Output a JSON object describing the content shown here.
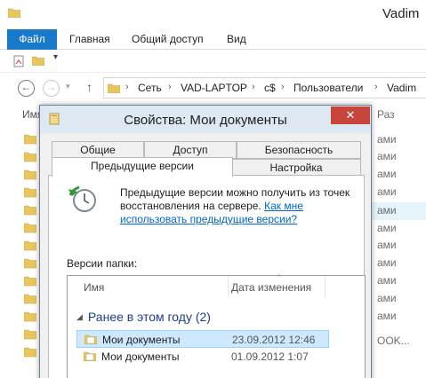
{
  "explorer": {
    "title": "Vadim",
    "ribbon_tabs": [
      "Файл",
      "Главная",
      "Общий доступ",
      "Вид"
    ],
    "address": [
      "Сеть",
      "VAD-LAPTOP",
      "c$",
      "Пользователи",
      "Vadim"
    ],
    "left_header": "Имя",
    "right_header": "Раз",
    "right_cells": [
      "ами",
      "ами",
      "ами",
      "ами",
      "ами",
      "ами",
      "ами",
      "ами",
      "ами",
      "ами",
      "ами",
      "OOK..."
    ]
  },
  "dialog": {
    "title": "Свойства: Мои документы",
    "close_label": "✕",
    "tabs_row1": [
      "Общие",
      "Доступ",
      "Безопасность"
    ],
    "tabs_row2": [
      "Предыдущие версии",
      "Настройка"
    ],
    "info_text": "Предыдущие версии можно получить из точек восстановления на сервере.",
    "info_link": "Как мне использовать предыдущие версии?",
    "versions_label": "Версии папки:",
    "columns": [
      "Имя",
      "Дата изменения"
    ],
    "group_label": "Ранее в этом году (2)",
    "rows": [
      {
        "name": "Мои документы",
        "date": "23.09.2012 12:46",
        "selected": true
      },
      {
        "name": "Мои документы",
        "date": "01.09.2012 1:07",
        "selected": false
      }
    ]
  },
  "colors": {
    "file_tab": "#1979ca",
    "close_button": "#c7453b",
    "link": "#0066cc",
    "selection": "#cde8ff"
  },
  "icons": [
    "folder-icon",
    "undo-icon",
    "back-icon",
    "forward-icon",
    "up-arrow-icon",
    "chevron-right-icon",
    "close-icon",
    "clock-arrow-icon"
  ]
}
